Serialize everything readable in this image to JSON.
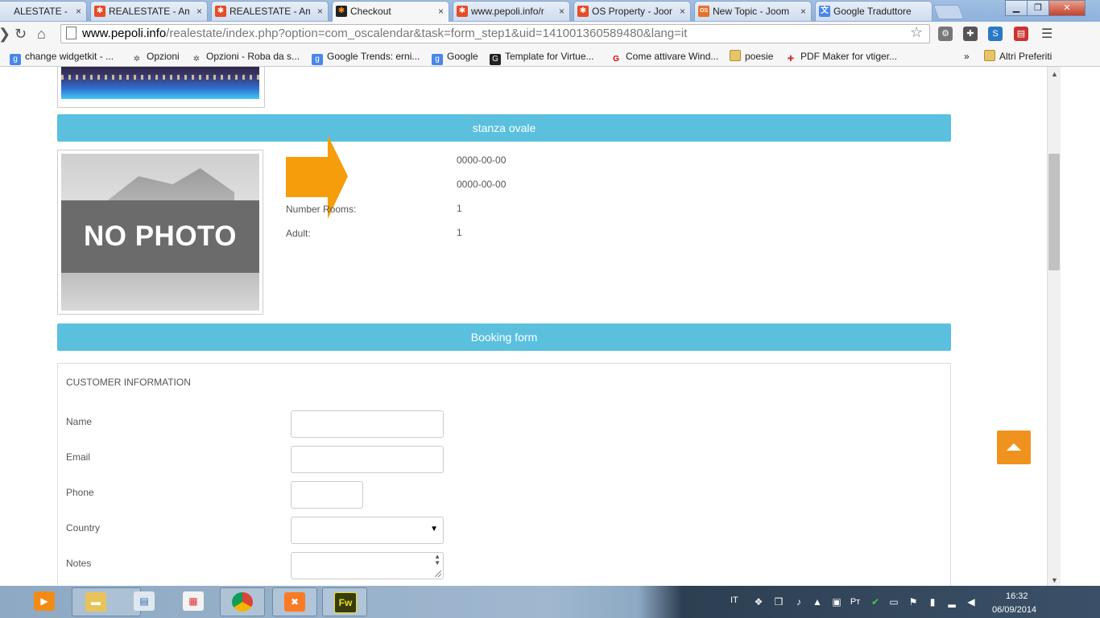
{
  "browser": {
    "tabs": [
      {
        "label": "ALESTATE - Am",
        "icon": "joomla-icon",
        "active": false
      },
      {
        "label": "REALESTATE - Am",
        "icon": "joomla-icon",
        "active": false
      },
      {
        "label": "REALESTATE - Am",
        "icon": "joomla-icon",
        "active": false
      },
      {
        "label": "Checkout",
        "icon": "joomla-icon",
        "active": true
      },
      {
        "label": "www.pepoli.info/r",
        "icon": "joomla-icon",
        "active": false
      },
      {
        "label": "OS Property - Joor",
        "icon": "joomla-icon",
        "active": false
      },
      {
        "label": "New Topic - Joom",
        "icon": "os-icon",
        "active": false
      },
      {
        "label": "Google Traduttore",
        "icon": "translate-icon",
        "active": false
      }
    ],
    "tab_close": "×",
    "url_host": "www.pepoli.info",
    "url_path": "/realestate/index.php?option=com_oscalendar&task=form_step1&uid=141001360589480&lang=it",
    "bookmarks": [
      {
        "label": "change widgetkit - ...",
        "icon": "google-icon"
      },
      {
        "label": "Opzioni",
        "icon": "gear-icon"
      },
      {
        "label": "Opzioni - Roba da s...",
        "icon": "gear-icon"
      },
      {
        "label": "Google Trends: erni...",
        "icon": "google-icon"
      },
      {
        "label": "Google",
        "icon": "google-icon"
      },
      {
        "label": "Template for Virtue...",
        "icon": "g-icon"
      },
      {
        "label": "Come attivare Wind...",
        "icon": "red-icon"
      },
      {
        "label": "poesie",
        "icon": "folder-icon"
      },
      {
        "label": "PDF Maker for vtiger...",
        "icon": "pdf-icon"
      }
    ],
    "bookmarks_more": "»",
    "other_bookmarks": "Altri Preferiti"
  },
  "page": {
    "room_title": "stanza ovale",
    "photo_placeholder": "NO PHOTO",
    "details": [
      {
        "label": "",
        "value": "0000-00-00"
      },
      {
        "label": "",
        "value": "0000-00-00"
      },
      {
        "label": "Number Rooms:",
        "value": "1"
      },
      {
        "label": "Adult:",
        "value": "1"
      }
    ],
    "booking_title": "Booking form",
    "form": {
      "heading": "CUSTOMER INFORMATION",
      "name_label": "Name",
      "email_label": "Email",
      "phone_label": "Phone",
      "country_label": "Country",
      "notes_label": "Notes",
      "name_value": "",
      "email_value": "",
      "phone_value": "",
      "country_value": "",
      "notes_value": ""
    }
  },
  "taskbar": {
    "language": "IT",
    "time": "16:32",
    "date": "06/09/2014",
    "apps": [
      "media-player-icon",
      "explorer-icon",
      "control-panel-icon",
      "apps-icon",
      "chrome-icon",
      "xampp-icon",
      "fireworks-icon"
    ],
    "fireworks_label": "Fw",
    "pt_label": "Pт"
  },
  "colors": {
    "section_bar": "#5bc0de",
    "back_to_top": "#f0931e",
    "arrow": "#f59d0b"
  }
}
